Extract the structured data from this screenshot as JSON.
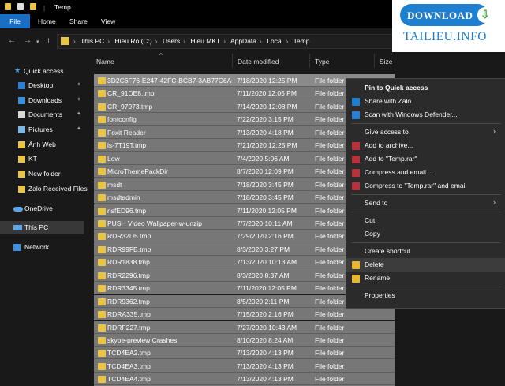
{
  "window": {
    "title": "Temp"
  },
  "ribbon": {
    "tabs": [
      "File",
      "Home",
      "Share",
      "View"
    ]
  },
  "address": {
    "crumbs": [
      "This PC",
      "Hieu Ro (C:)",
      "Users",
      "Hieu MKT",
      "AppData",
      "Local",
      "Temp"
    ]
  },
  "sidebar": {
    "items": [
      {
        "label": "Quick access",
        "icon": "star-icon"
      },
      {
        "label": "Desktop",
        "icon": "desktop-icon",
        "pinned": true
      },
      {
        "label": "Downloads",
        "icon": "download-icon",
        "pinned": true
      },
      {
        "label": "Documents",
        "icon": "documents-icon",
        "pinned": true
      },
      {
        "label": "Pictures",
        "icon": "pictures-icon",
        "pinned": true
      },
      {
        "label": "Ảnh Web",
        "icon": "folder-icon"
      },
      {
        "label": "KT",
        "icon": "folder-icon"
      },
      {
        "label": "New folder",
        "icon": "folder-icon"
      },
      {
        "label": "Zalo Received Files",
        "icon": "folder-icon"
      },
      {
        "label": "OneDrive",
        "icon": "cloud-icon"
      },
      {
        "label": "This PC",
        "icon": "computer-icon",
        "selected": true
      },
      {
        "label": "Network",
        "icon": "network-icon"
      }
    ]
  },
  "columns": {
    "name": "Name",
    "date": "Date modified",
    "type": "Type",
    "size": "Size"
  },
  "files": [
    {
      "name": "3D2C6F76-E247-42FC-BCB7-3AB77C6A53...",
      "date": "7/18/2020 12:25 PM",
      "type": "File folder"
    },
    {
      "name": "CR_91DE8.tmp",
      "date": "7/11/2020 12:05 PM",
      "type": "File folder"
    },
    {
      "name": "CR_97973.tmp",
      "date": "7/14/2020 12:08 PM",
      "type": "File folder"
    },
    {
      "name": "fontconfig",
      "date": "7/22/2020 3:15 PM",
      "type": "File folder"
    },
    {
      "name": "Foxit Reader",
      "date": "7/13/2020 4:18 PM",
      "type": "File folder"
    },
    {
      "name": "is-7T19T.tmp",
      "date": "7/21/2020 12:25 PM",
      "type": "File folder"
    },
    {
      "name": "Low",
      "date": "7/4/2020 5:06 AM",
      "type": "File folder"
    },
    {
      "name": "MicroThemePackDir",
      "date": "8/7/2020 12:09 PM",
      "type": "File folder"
    },
    {
      "name": "msdt",
      "date": "7/18/2020 3:45 PM",
      "type": "File folder"
    },
    {
      "name": "msdtadmin",
      "date": "7/18/2020 3:45 PM",
      "type": "File folder"
    },
    {
      "name": "nsfED96.tmp",
      "date": "7/11/2020 12:05 PM",
      "type": "File folder"
    },
    {
      "name": "PUSH Video Wallpaper-w-unzip",
      "date": "7/7/2020 10:11 AM",
      "type": "File folder"
    },
    {
      "name": "RDR32D5.tmp",
      "date": "7/29/2020 2:16 PM",
      "type": "File folder"
    },
    {
      "name": "RDR99FB.tmp",
      "date": "8/3/2020 3:27 PM",
      "type": "File folder"
    },
    {
      "name": "RDR1838.tmp",
      "date": "7/13/2020 10:13 AM",
      "type": "File folder"
    },
    {
      "name": "RDR2296.tmp",
      "date": "8/3/2020 8:37 AM",
      "type": "File folder"
    },
    {
      "name": "RDR3345.tmp",
      "date": "7/11/2020 12:05 PM",
      "type": "File folder"
    },
    {
      "name": "RDR9362.tmp",
      "date": "8/5/2020 2:11 PM",
      "type": "File folder"
    },
    {
      "name": "RDRA335.tmp",
      "date": "7/15/2020 2:16 PM",
      "type": "File folder"
    },
    {
      "name": "RDRF227.tmp",
      "date": "7/27/2020 10:43 AM",
      "type": "File folder"
    },
    {
      "name": "skype-preview Crashes",
      "date": "8/10/2020 8:24 AM",
      "type": "File folder"
    },
    {
      "name": "TCD4EA2.tmp",
      "date": "7/13/2020 4:13 PM",
      "type": "File folder"
    },
    {
      "name": "TCD4EA3.tmp",
      "date": "7/13/2020 4:13 PM",
      "type": "File folder"
    },
    {
      "name": "TCD4EA4.tmp",
      "date": "7/13/2020 4:13 PM",
      "type": "File folder"
    }
  ],
  "context_menu": {
    "items": [
      {
        "label": "Pin to Quick access",
        "bold": true
      },
      {
        "label": "Share with Zalo",
        "icon": "zalo-icon",
        "color": "#1e7fd0"
      },
      {
        "label": "Scan with Windows Defender...",
        "icon": "shield-icon",
        "color": "#2c7fd6"
      },
      {
        "sep": true
      },
      {
        "label": "Give access to",
        "submenu": true
      },
      {
        "label": "Add to archive...",
        "icon": "winrar-icon",
        "color": "#b8323a"
      },
      {
        "label": "Add to \"Temp.rar\"",
        "icon": "winrar-icon",
        "color": "#b8323a"
      },
      {
        "label": "Compress and email...",
        "icon": "winrar-icon",
        "color": "#b8323a"
      },
      {
        "label": "Compress to \"Temp.rar\" and email",
        "icon": "winrar-icon",
        "color": "#b8323a"
      },
      {
        "sep": true
      },
      {
        "label": "Send to",
        "submenu": true
      },
      {
        "sep": true
      },
      {
        "label": "Cut"
      },
      {
        "label": "Copy"
      },
      {
        "sep": true
      },
      {
        "label": "Create shortcut"
      },
      {
        "label": "Delete",
        "icon": "shield-uac-icon",
        "color": "#e8b830",
        "highlight": true
      },
      {
        "label": "Rename",
        "icon": "shield-uac-icon",
        "color": "#e8b830"
      },
      {
        "sep": true
      },
      {
        "label": "Properties"
      }
    ]
  },
  "watermark": {
    "badge": "DOWNLOAD",
    "site": "TAILIEU.INFO"
  },
  "colors": {
    "accent": "#1a6fc4",
    "folder": "#e8c44a",
    "selection": "#777777"
  }
}
